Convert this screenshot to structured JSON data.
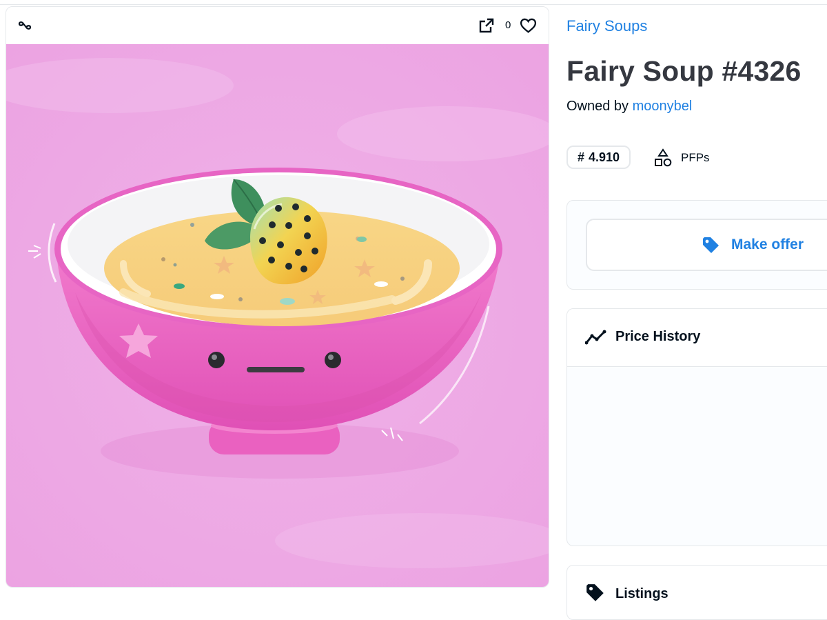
{
  "media": {
    "favorite_count": "0",
    "icons": [
      "chain-icon",
      "open-external-icon",
      "heart-icon"
    ],
    "artwork_description_name": "fairy-soup-artwork"
  },
  "item": {
    "collection_name": "Fairy Soups",
    "title": "Fairy Soup #4326",
    "owned_by_prefix": "Owned by",
    "owner_name": "moonybel",
    "rank_prefix": "#",
    "rank_value": "4.910",
    "category": "PFPs"
  },
  "offer": {
    "button_label": "Make offer"
  },
  "price_history": {
    "title": "Price History"
  },
  "listings": {
    "title": "Listings"
  },
  "colors": {
    "accent": "#2081e2",
    "title": "#353840",
    "border": "#e5e8eb",
    "background_pink": "#eeaae6",
    "bowl_pink": "#e55fbe"
  }
}
